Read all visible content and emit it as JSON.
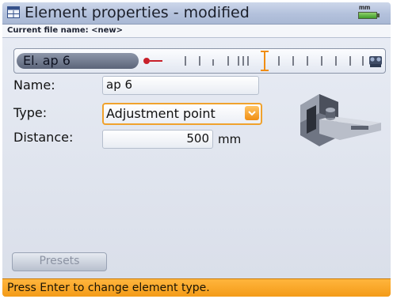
{
  "window": {
    "title": "Element properties - modified",
    "unit_badge": "mm",
    "icons": {
      "app": "window-icon",
      "battery": "battery-icon"
    }
  },
  "file": {
    "label": "Current file name: <new>"
  },
  "element_bar": {
    "label": "El. ap 6",
    "icons": [
      "pin-marker-icon",
      "cursor-bracket-icon",
      "machine-icon"
    ]
  },
  "form": {
    "name": {
      "label": "Name:",
      "value": "ap 6"
    },
    "type": {
      "label": "Type:",
      "value": "Adjustment point",
      "icon": "chevron-down-icon"
    },
    "distance": {
      "label": "Distance:",
      "value": "500",
      "unit": "mm"
    }
  },
  "illustration": {
    "icon": "adjustment-point-illustration"
  },
  "buttons": {
    "presets": "Presets"
  },
  "status": {
    "text": "Press Enter to change element type."
  },
  "colors": {
    "accent_orange": "#f39a16",
    "title_bar": "#b3c1dc",
    "marker_red": "#c8202a"
  }
}
